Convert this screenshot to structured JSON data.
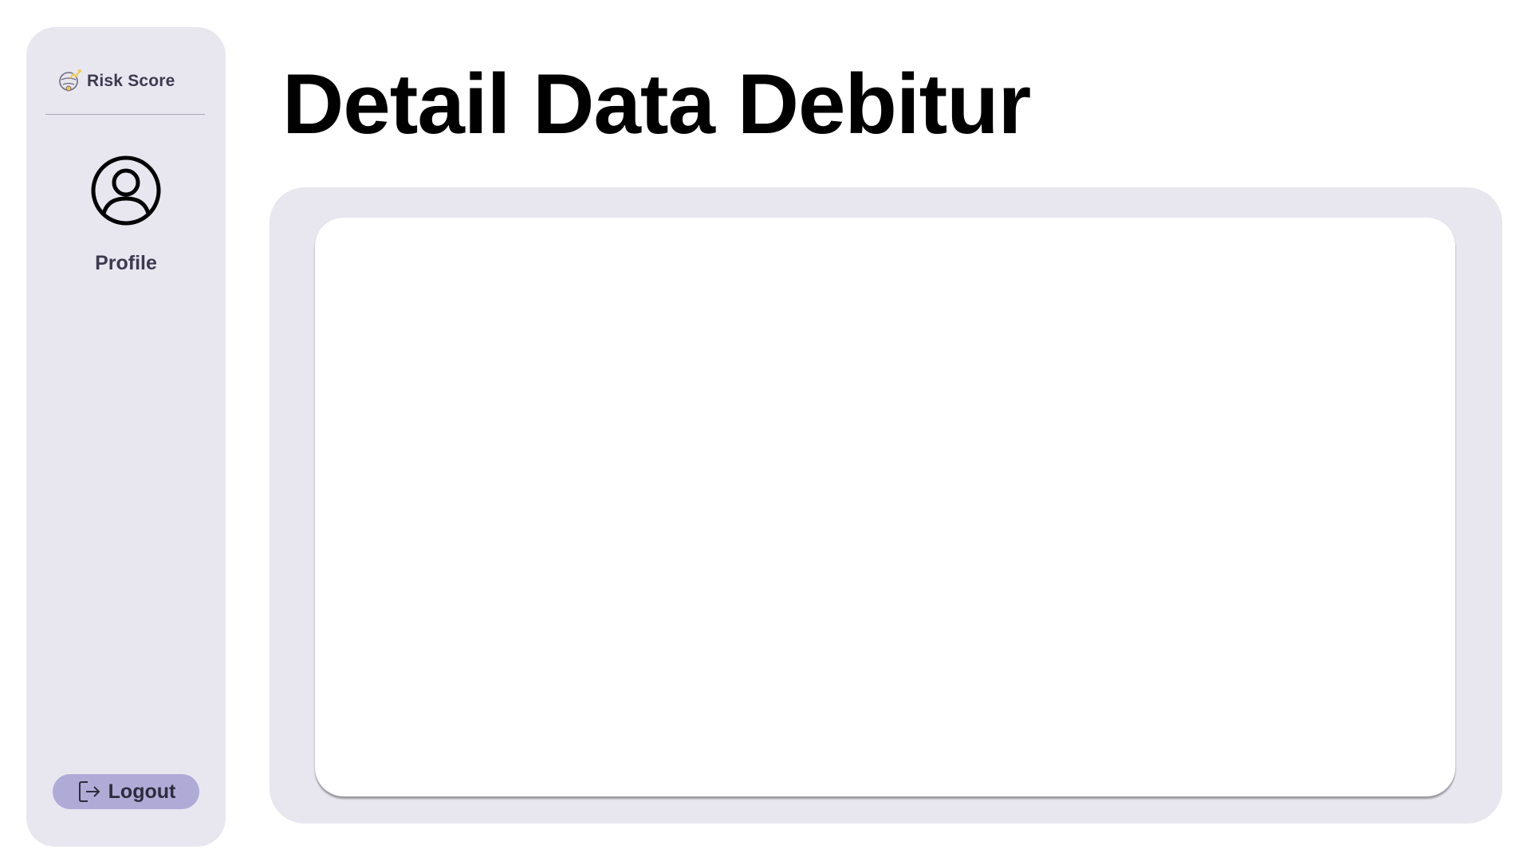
{
  "sidebar": {
    "brand": {
      "name": "Risk Score",
      "logo_icon": "brain-graph-icon"
    },
    "nav": [
      {
        "label": "Profile",
        "icon": "user-circle-icon"
      }
    ],
    "logout": {
      "label": "Logout",
      "icon": "logout-icon"
    }
  },
  "main": {
    "title": "Detail Data Debitur"
  },
  "colors": {
    "sidebar_bg": "#e8e7f0",
    "panel_bg": "#e8e7f0",
    "card_bg": "#ffffff",
    "logout_bg": "#b0abd6",
    "text_dark": "#3d3a4f",
    "title": "#000000",
    "logo_accent": "#f2c94c"
  }
}
